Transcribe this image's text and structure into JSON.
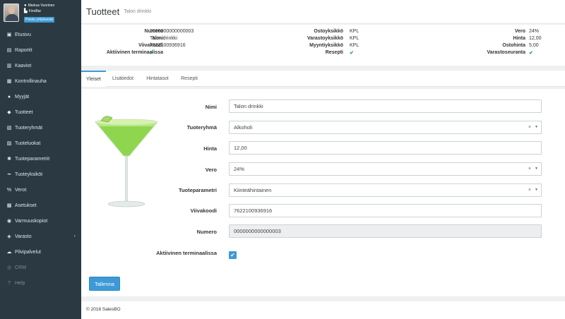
{
  "user": {
    "name": "Markus Vuorinen",
    "company": "FinnBar",
    "logout_label": "Poistu yrityksestä"
  },
  "sidebar": {
    "items": [
      {
        "label": "Etusivu",
        "icon": "dashboard-icon"
      },
      {
        "label": "Raportit",
        "icon": "report-icon"
      },
      {
        "label": "Kaaviot",
        "icon": "chart-icon"
      },
      {
        "label": "Kontrollinauha",
        "icon": "receipt-icon"
      },
      {
        "label": "Myyjät",
        "icon": "users-icon"
      },
      {
        "label": "Tuotteet",
        "icon": "tag-icon"
      },
      {
        "label": "Tuoteryhmät",
        "icon": "folder-icon"
      },
      {
        "label": "Tuoteluokat",
        "icon": "class-icon"
      },
      {
        "label": "Tuoteparametrit",
        "icon": "gear-icon"
      },
      {
        "label": "Tuoteyksiköt",
        "icon": "unit-icon"
      },
      {
        "label": "Verot",
        "icon": "percent-icon"
      },
      {
        "label": "Asetukset",
        "icon": "settings-icon"
      },
      {
        "label": "Varmuuskopiot",
        "icon": "backup-icon"
      },
      {
        "label": "Varasto",
        "icon": "stock-icon"
      },
      {
        "label": "Pilvipalvelut",
        "icon": "cloud-icon"
      },
      {
        "label": "CRM",
        "icon": "crm-icon"
      },
      {
        "label": "Help",
        "icon": "help-icon"
      }
    ]
  },
  "header": {
    "title": "Tuotteet",
    "subtitle": "Talon drinkki"
  },
  "info": {
    "col1": [
      {
        "label": "Numero",
        "value": "0000000000000003"
      },
      {
        "label": "Nimi",
        "value": "Talon drinkki"
      },
      {
        "label": "Viivakoodi",
        "value": "7622100936916"
      },
      {
        "label": "Aktiivinen terminaalissa",
        "value": "✔"
      }
    ],
    "col2": [
      {
        "label": "Ostoyksikkö",
        "value": "KPL"
      },
      {
        "label": "Varastoyksikkö",
        "value": "KPL"
      },
      {
        "label": "Myyntiyksikkö",
        "value": "KPL"
      },
      {
        "label": "Resepti",
        "value": "✔"
      }
    ],
    "col3": [
      {
        "label": "Vero",
        "value": "24%"
      },
      {
        "label": "Hinta",
        "value": "12,00"
      },
      {
        "label": "Ostohinta",
        "value": "5,00"
      },
      {
        "label": "Varastoseuranta",
        "value": "✔"
      }
    ]
  },
  "tabs": [
    "Yleiset",
    "Lisätiedot",
    "Hintatasot",
    "Resepti"
  ],
  "form": {
    "nimi": {
      "label": "Nimi",
      "value": "Talon drinkki"
    },
    "tuoteryhma": {
      "label": "Tuoteryhmä",
      "value": "Alkoholi"
    },
    "hinta": {
      "label": "Hinta",
      "value": "12,00"
    },
    "vero": {
      "label": "Vero",
      "value": "24%"
    },
    "tuoteparametri": {
      "label": "Tuoteparametri",
      "value": "Kiinteähintainen"
    },
    "viivakoodi": {
      "label": "Viivakoodi",
      "value": "7622100936916"
    },
    "numero": {
      "label": "Numero",
      "value": "0000000000000003"
    },
    "aktiivinen": {
      "label": "Aktiivinen terminaalissa",
      "checked": true
    },
    "clear_symbol": "×",
    "save_label": "Tallenna"
  },
  "footer": {
    "text": "© 2018 SalesBO"
  },
  "colors": {
    "sidebar": "#2b3a42",
    "accent": "#3e9ad6",
    "check": "#22a352"
  }
}
